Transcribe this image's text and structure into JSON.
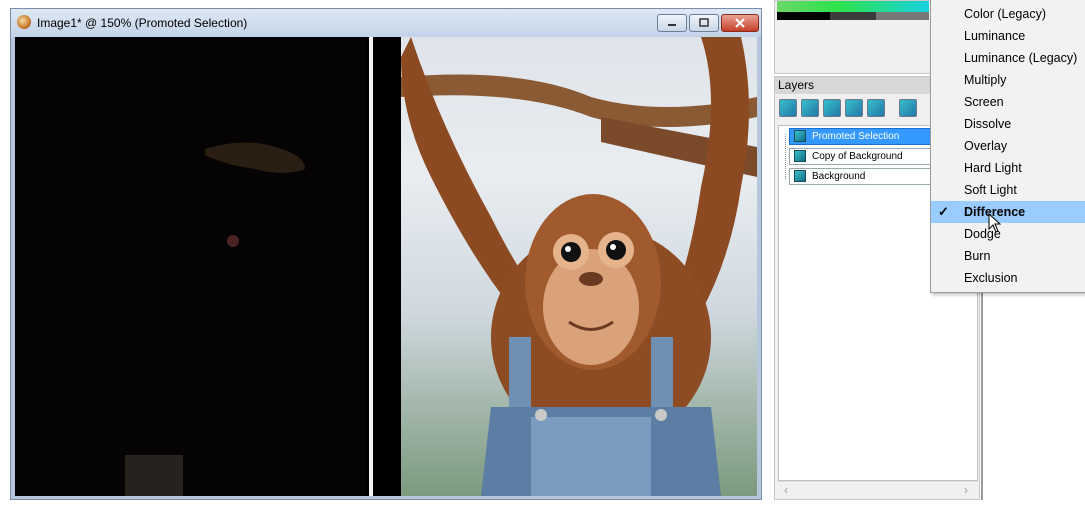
{
  "image_window": {
    "title": "Image1* @ 150% (Promoted Selection)"
  },
  "layers_panel": {
    "title": "Layers",
    "layers": [
      {
        "name": "Promoted Selection",
        "selected": true
      },
      {
        "name": "Copy of Background",
        "selected": false
      },
      {
        "name": "Background",
        "selected": false
      }
    ]
  },
  "blend_menu": {
    "items": [
      {
        "label": "Color (Legacy)"
      },
      {
        "label": "Luminance"
      },
      {
        "label": "Luminance (Legacy)"
      },
      {
        "label": "Multiply"
      },
      {
        "label": "Screen"
      },
      {
        "label": "Dissolve"
      },
      {
        "label": "Overlay"
      },
      {
        "label": "Hard Light"
      },
      {
        "label": "Soft Light"
      },
      {
        "label": "Difference"
      },
      {
        "label": "Dodge"
      },
      {
        "label": "Burn"
      },
      {
        "label": "Exclusion"
      }
    ],
    "checked": "Difference"
  },
  "colors": {
    "selection_blue": "#3399ff",
    "menu_highlight": "#99ccff"
  }
}
